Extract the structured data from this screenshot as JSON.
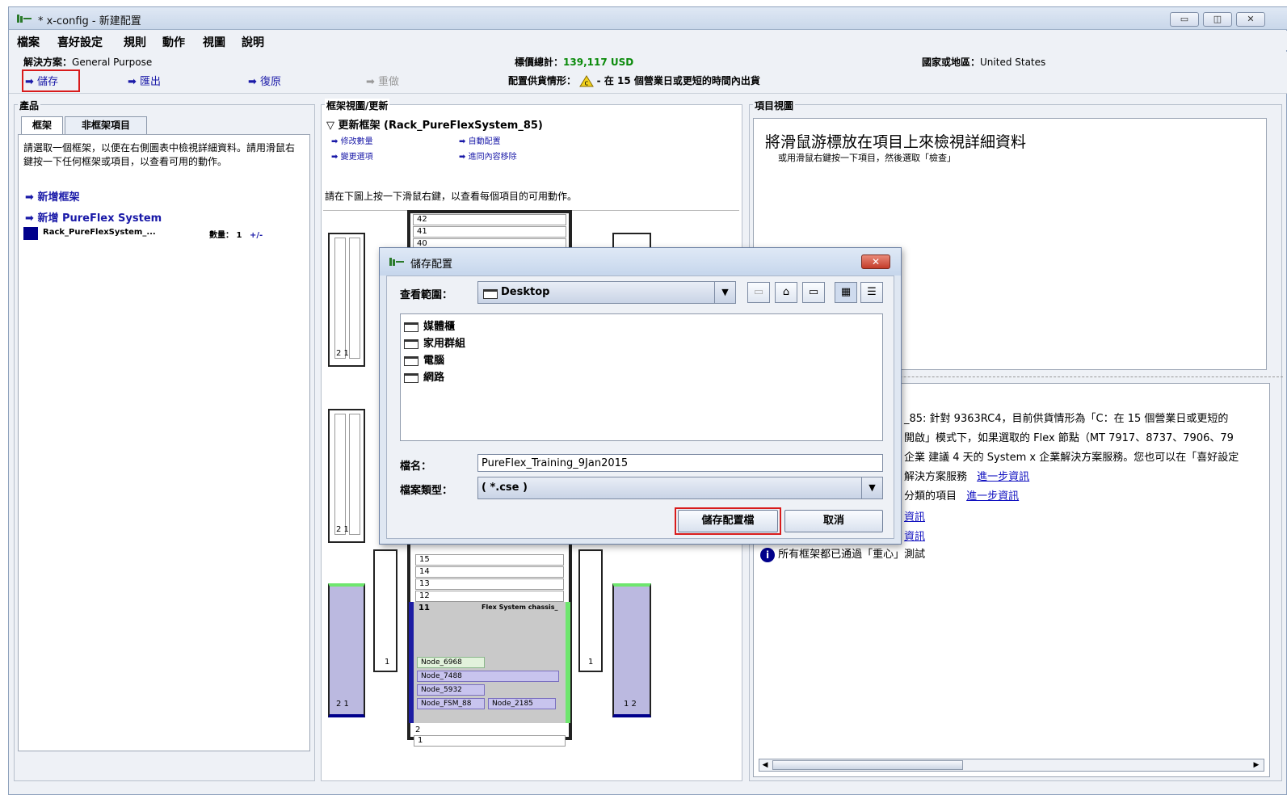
{
  "window": {
    "title": "* x-config - 新建配置",
    "controls": {
      "minimize": "▭",
      "maximize": "◫",
      "close": "✕"
    }
  },
  "menu": [
    "檔案",
    "喜好設定",
    "規則",
    "動作",
    "視圖",
    "說明"
  ],
  "info": {
    "solution_label": "解決方案：",
    "solution_value": "General Purpose",
    "price_label": "標價總計：",
    "price_value": "139,117 USD",
    "country_label": "國家或地區：",
    "country_value": "United States",
    "supply_label": "配置供貨情形：",
    "supply_value": "- 在 15 個營業日或更短的時間內出貨"
  },
  "toolbar": {
    "save": "儲存",
    "export": "匯出",
    "undo": "復原",
    "redo": "重做"
  },
  "left": {
    "legend": "產品",
    "tabs": [
      "框架",
      "非框架項目"
    ],
    "description": "請選取一個框架，以便在右側圖表中檢視詳細資料。請用滑鼠右鍵按一下任何框架或項目，以查看可用的動作。",
    "add_rack": "新增框架",
    "add_pureflex": "新增 PureFlex System",
    "item_name": "Rack_PureFlexSystem_...",
    "qty_label": "數量：",
    "qty_value": "1",
    "qty_adjust": "+/-"
  },
  "middle": {
    "legend": "框架視圖/更新",
    "header": "▽ 更新框架 (Rack_PureFlexSystem_85)",
    "links": [
      "修改數量",
      "自動配置",
      "變更選項",
      "進同內容移除"
    ],
    "hint": "請在下圖上按一下滑鼠右鍵，以查看每個項目的可用動作。",
    "top_slots": [
      "42",
      "41",
      "40"
    ],
    "bottom_slots": [
      "15",
      "14",
      "13",
      "12"
    ],
    "chassis_slot": "11",
    "chassis_label": "Flex System chassis_",
    "nodes": [
      "Node_6968",
      "Node_7488",
      "Node_5932",
      "Node_FSM_88",
      "Node_2185"
    ],
    "low_slots": [
      "2",
      "1"
    ],
    "pdu_labels": {
      "a": "2 1",
      "b": "2 1",
      "c": "1",
      "d": "1",
      "e": "2 1",
      "f": "1 2"
    }
  },
  "right": {
    "legend": "項目視圖",
    "title": "將滑鼠游標放在項目上來檢視詳細資料",
    "subtitle": "或用滑鼠右鍵按一下項目，然後選取「檢查」",
    "messages": [
      "_85: 針對 9363RC4，目前供貨情形為「C：在 15 個營業日或更短的",
      "開啟」模式下，如果選取的 Flex 節點（MT 7917、8737、7906、79",
      "企業 建議 4 天的 System x 企業解決方案服務。您也可以在「喜好設定",
      "解決方案服務",
      "分類的項目",
      "資訊",
      "資訊",
      "所有框架都已通過「重心」測試"
    ],
    "more_info": "進一步資訊"
  },
  "dialog": {
    "title": "儲存配置",
    "lookin_label": "查看範圍：",
    "lookin_value": "Desktop",
    "files": [
      "媒體櫃",
      "家用群組",
      "電腦",
      "網路"
    ],
    "filename_label": "檔名：",
    "filename_value": "PureFlex_Training_9Jan2015",
    "filetype_label": "檔案類型：",
    "filetype_value": "( *.cse )",
    "save_button": "儲存配置檔",
    "cancel_button": "取消"
  }
}
